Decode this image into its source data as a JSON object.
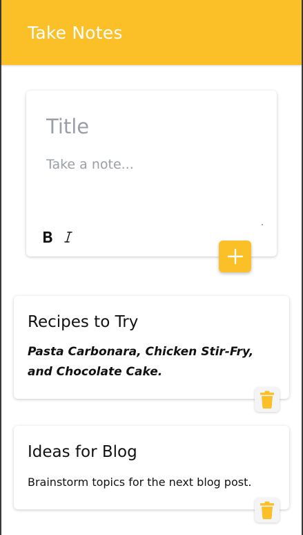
{
  "header": {
    "title": "Take Notes"
  },
  "composer": {
    "title_placeholder": "Title",
    "note_placeholder": "Take a note...",
    "format": {
      "bold_icon": "bold-icon",
      "italic_icon": "italic-icon"
    },
    "add_icon": "plus-icon"
  },
  "notes": [
    {
      "title": "Recipes to Try",
      "content": "Pasta Carbonara, Chicken Stir-Fry, and Chocolate Cake.",
      "style": "bold-italic",
      "delete_icon": "trash-icon"
    },
    {
      "title": "Ideas for Blog",
      "content": "Brainstorm topics for the next blog post.",
      "style": "plain",
      "delete_icon": "trash-icon"
    }
  ],
  "colors": {
    "accent": "#fbc027",
    "header_text": "#ffffff",
    "placeholder": "#9a9ea8",
    "text": "#111111"
  }
}
